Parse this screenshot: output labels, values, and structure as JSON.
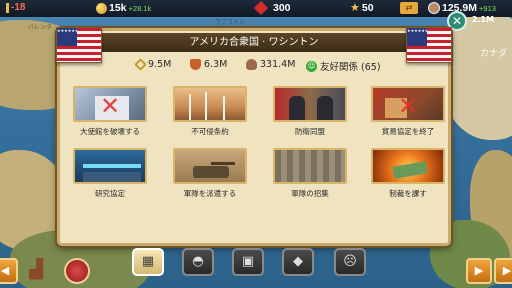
{
  "topbar": {
    "level": "-18",
    "gold": "15k",
    "gold_income": "+28.1k",
    "gems": "300",
    "stars": "50",
    "population": "125.9M",
    "population_income": "+913"
  },
  "map": {
    "labels": [
      "バレンタ",
      "ラブラドル",
      "カナダ"
    ],
    "side_population": "2.1M"
  },
  "dialog": {
    "title": "アメリカ合衆国 · ワシントン",
    "stats": {
      "stat1": "9.5M",
      "stat2": "6.3M",
      "stat3": "331.4M",
      "relation": "友好関係 (65)"
    },
    "actions": [
      {
        "label": "大使館を破壊する",
        "icon": "embassy-destroyed"
      },
      {
        "label": "不可侵条約",
        "icon": "wind-turbines"
      },
      {
        "label": "防衛同盟",
        "icon": "leaders-handshake"
      },
      {
        "label": "貿易協定を終了",
        "icon": "trade-cancelled"
      },
      {
        "label": "研究協定",
        "icon": "research-lab"
      },
      {
        "label": "軍隊を派遣する",
        "icon": "tank-desert"
      },
      {
        "label": "軍隊の招集",
        "icon": "soldiers-rally"
      },
      {
        "label": "制裁を課す",
        "icon": "money-burning"
      }
    ]
  },
  "colors": {
    "panel_bg": "#efe3c0",
    "title_bg": "#4a3620",
    "relation_green": "#3aa83a",
    "ocean": "#3a77a4"
  }
}
